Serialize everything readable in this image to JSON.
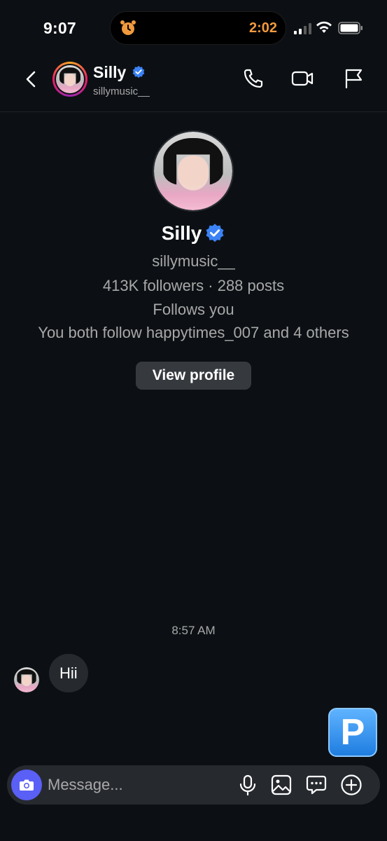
{
  "status_bar": {
    "time": "9:07",
    "timer": "2:02",
    "icons": [
      "alarm-icon",
      "signal-icon",
      "wifi-icon",
      "battery-icon"
    ],
    "timer_color": "#f19a3e"
  },
  "header": {
    "name": "Silly",
    "username": "sillymusic__",
    "icons": [
      "back-icon",
      "phone-icon",
      "video-icon",
      "flag-icon"
    ]
  },
  "profile": {
    "name": "Silly",
    "username": "sillymusic__",
    "stats": "413K followers · 288 posts",
    "follows_status": "Follows you",
    "mutuals": "You both follow happytimes_007 and 4 others",
    "view_profile_label": "View profile",
    "verified_color": "#3b82f6"
  },
  "chat": {
    "timestamp": "8:57 AM",
    "messages": [
      {
        "sender": "Silly",
        "text": "Hii"
      }
    ],
    "badge_letter": "P"
  },
  "composer": {
    "placeholder": "Message...",
    "icons": [
      "camera-icon",
      "microphone-icon",
      "gallery-icon",
      "sticker-icon",
      "plus-icon"
    ],
    "camera_color": "#5a5ff5"
  },
  "colors": {
    "background": "#0c1014",
    "bubble": "#262a2f",
    "secondary_text": "#a8a8a8"
  }
}
